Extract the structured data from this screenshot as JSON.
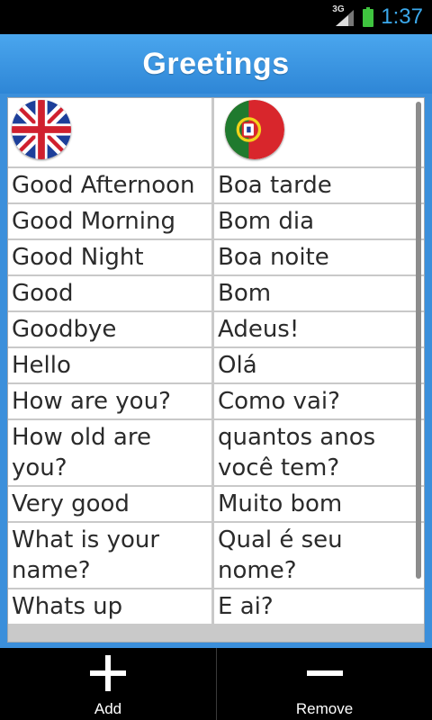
{
  "status": {
    "network": "3G",
    "time": "1:37"
  },
  "app": {
    "title": "Greetings"
  },
  "columns": {
    "english_flag": "uk-flag-icon",
    "portuguese_flag": "portugal-flag-icon"
  },
  "rows": [
    {
      "en": "Good Afternoon",
      "pt": "Boa tarde"
    },
    {
      "en": "Good Morning",
      "pt": "Bom dia"
    },
    {
      "en": "Good Night",
      "pt": "Boa noite"
    },
    {
      "en": "Good",
      "pt": "Bom"
    },
    {
      "en": "Goodbye",
      "pt": "Adeus!"
    },
    {
      "en": "Hello",
      "pt": "Olá"
    },
    {
      "en": "How are you?",
      "pt": "Como vai?"
    },
    {
      "en": "How old are you?",
      "pt": "quantos anos você tem?"
    },
    {
      "en": "Very good",
      "pt": "Muito bom"
    },
    {
      "en": "What is your name?",
      "pt": "Qual é seu nome?"
    },
    {
      "en": "Whats up",
      "pt": "E ai?"
    }
  ],
  "bottom": {
    "add_label": "Add",
    "remove_label": "Remove"
  },
  "colors": {
    "accent": "#3b8fdb",
    "status_text": "#3ba9ec"
  }
}
